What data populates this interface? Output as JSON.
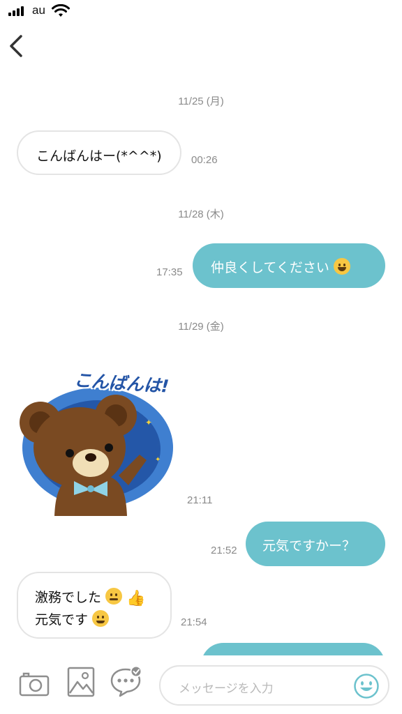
{
  "status_bar": {
    "carrier": "au"
  },
  "messages": [
    {
      "date": "11/25 (月)"
    },
    {
      "direction": "in",
      "text": "こんばんはー(*^^*)",
      "time": "00:26"
    },
    {
      "date": "11/28 (木)"
    },
    {
      "direction": "out",
      "text": "仲良くしてください",
      "time": "17:35"
    },
    {
      "date": "11/29 (金)"
    },
    {
      "direction": "in",
      "sticker_text": "こんばんは!",
      "time": "21:11"
    },
    {
      "direction": "out",
      "text": "元気ですかー？",
      "time": "21:52"
    },
    {
      "direction": "in",
      "line1": "激務でした",
      "line2": "元気です",
      "time": "21:54"
    }
  ],
  "input_bar": {
    "placeholder": "メッセージを入力"
  },
  "colors": {
    "outgoing": "#6cc2cd",
    "incoming_border": "#e4e4e4",
    "timestamp": "#8a8a8a"
  },
  "icons": [
    "back-chevron-icon",
    "camera-icon",
    "image-icon",
    "chat-bubble-icon",
    "smiley-icon"
  ]
}
